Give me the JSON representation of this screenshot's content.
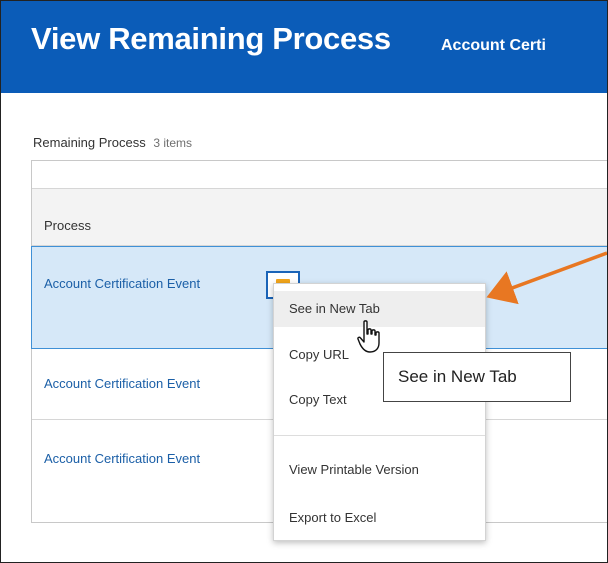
{
  "header": {
    "title": "View Remaining Process",
    "subtitle": "Account Certi"
  },
  "section": {
    "label": "Remaining Process",
    "count": "3 items"
  },
  "grid": {
    "column_header": "Process",
    "rows": [
      {
        "link": "Account Certification Event"
      },
      {
        "link": "Account Certification Event"
      },
      {
        "link": "Account Certification Event"
      }
    ]
  },
  "context_menu": {
    "items": [
      {
        "label": "See in New Tab"
      },
      {
        "label": "Copy URL"
      },
      {
        "label": "Copy Text"
      },
      {
        "label": "View Printable Version"
      },
      {
        "label": "Export to Excel"
      }
    ]
  },
  "tooltip": {
    "text": "See in New Tab"
  },
  "colors": {
    "header_bg": "#0b5cb8",
    "link": "#1b5fa7",
    "selected_row": "#d6e8f8",
    "annotation_arrow": "#e87722",
    "related_actions_icon": "#f2a51b"
  },
  "icons": {
    "related_actions": "related-actions-icon",
    "cursor": "hand-pointer-icon",
    "annotation": "annotation-arrow-icon"
  }
}
